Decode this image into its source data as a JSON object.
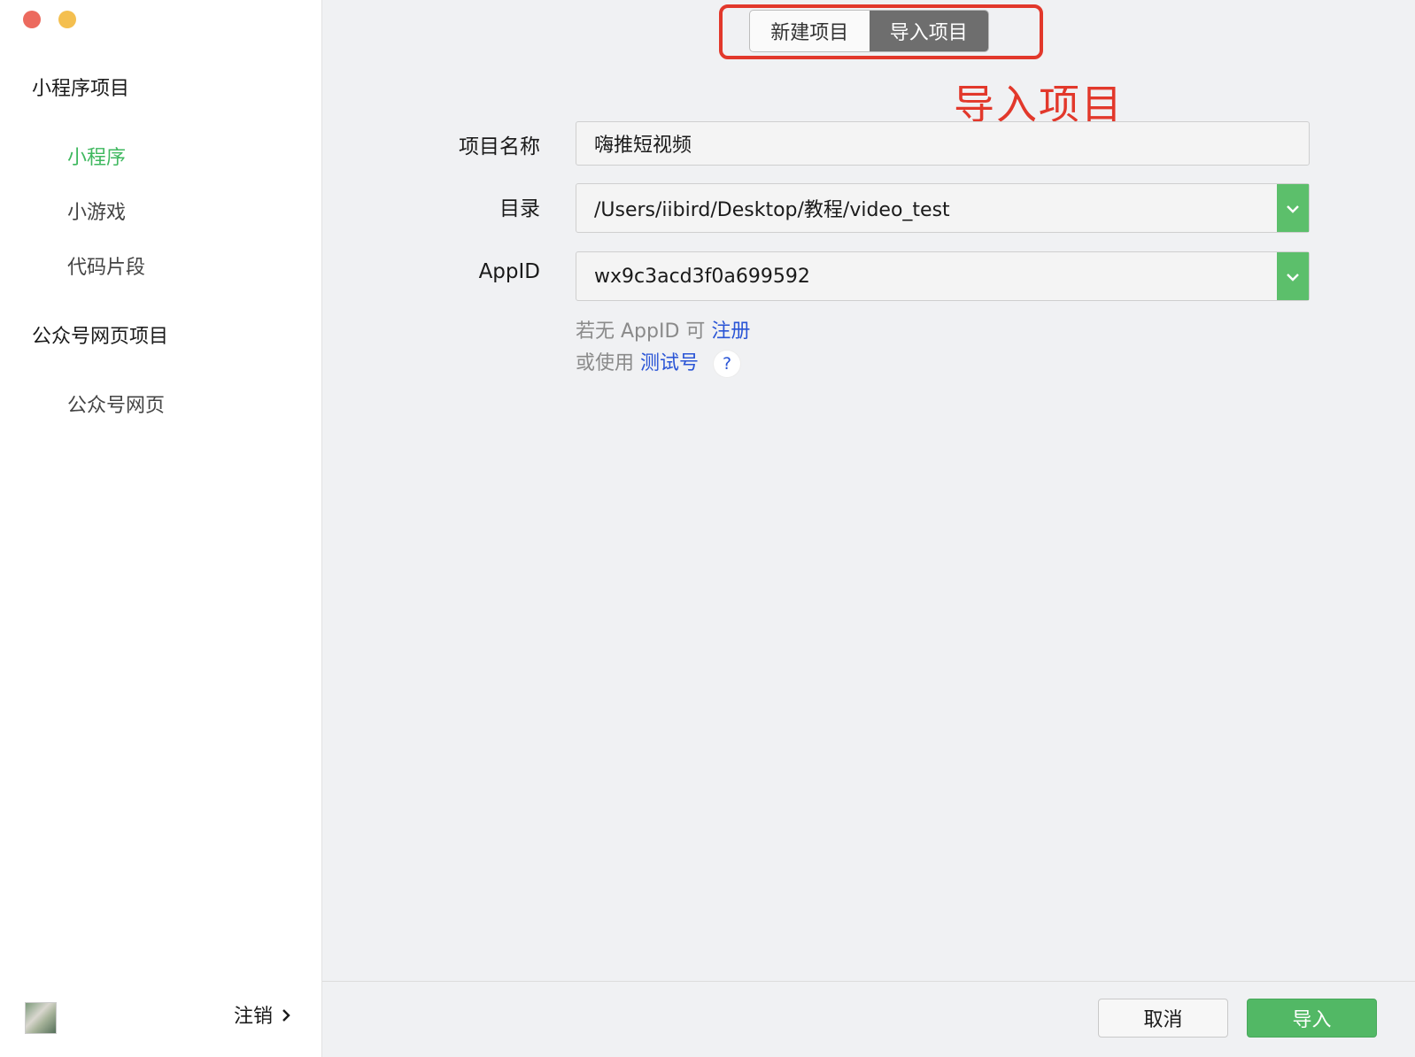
{
  "colors": {
    "close": "#ec6a5e",
    "minimize": "#f4bf4f",
    "accent_green": "#3fb85f",
    "annotation_red": "#e2382b",
    "link_blue": "#2a55d6"
  },
  "sidebar": {
    "groups": [
      {
        "title": "小程序项目",
        "items": [
          {
            "label": "小程序",
            "active": true
          },
          {
            "label": "小游戏",
            "active": false
          },
          {
            "label": "代码片段",
            "active": false
          }
        ]
      },
      {
        "title": "公众号网页项目",
        "items": [
          {
            "label": "公众号网页",
            "active": false
          }
        ]
      }
    ],
    "logout_label": "注销"
  },
  "tabs": [
    {
      "label": "新建项目",
      "active": false
    },
    {
      "label": "导入项目",
      "active": true
    }
  ],
  "annotation": {
    "text": "导入项目"
  },
  "form": {
    "project_name": {
      "label": "项目名称",
      "value": "嗨推短视频"
    },
    "directory": {
      "label": "目录",
      "value": "/Users/iibird/Desktop/教程/video_test"
    },
    "appid": {
      "label": "AppID",
      "value": "wx9c3acd3f0a699592"
    },
    "hint_line1": {
      "prefix": "若无 AppID 可",
      "link": "注册"
    },
    "hint_line2": {
      "prefix": "或使用",
      "link": "测试号",
      "help": "?"
    }
  },
  "footer": {
    "cancel_label": "取消",
    "import_label": "导入"
  }
}
